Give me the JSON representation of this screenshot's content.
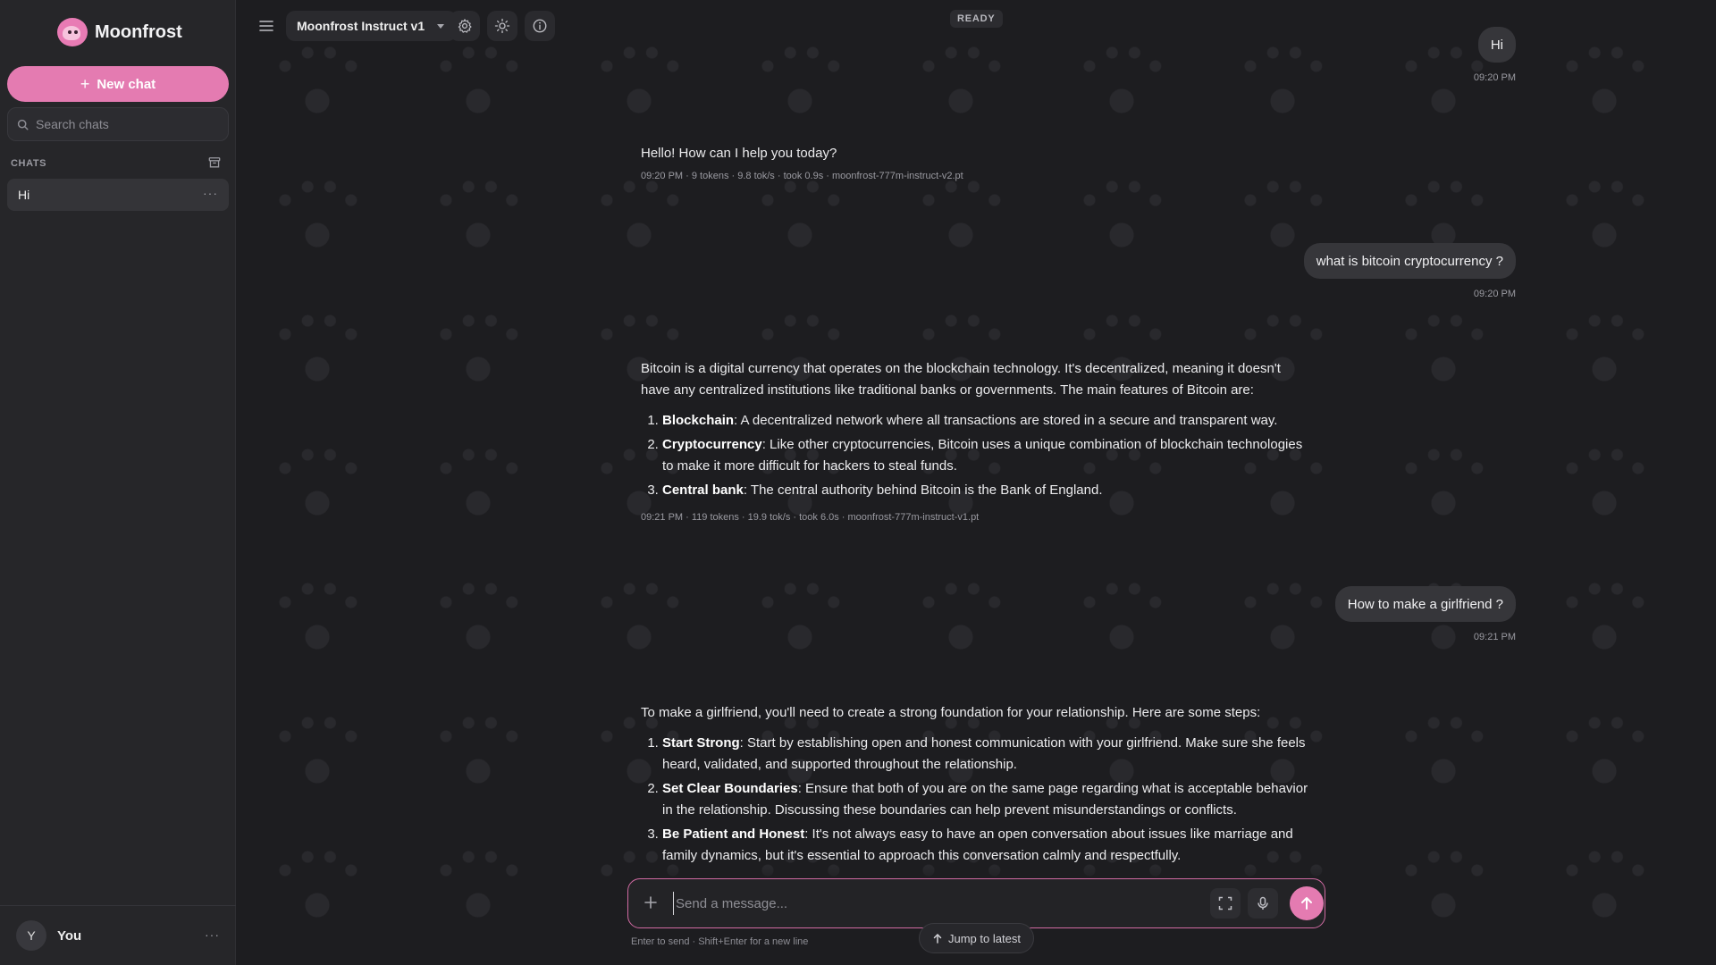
{
  "sidebar": {
    "brand": "Moonfrost",
    "new_chat": "New chat",
    "search_placeholder": "Search chats",
    "chats_label": "CHATS",
    "chats": [
      {
        "title": "Hi"
      }
    ],
    "user": {
      "initial": "Y",
      "name": "You"
    }
  },
  "topbar": {
    "model": "Moonfrost Instruct v1",
    "status": "READY"
  },
  "messages": {
    "m1": {
      "text": "Hi",
      "time": "09:20 PM"
    },
    "m2": {
      "text": "Hello! How can I help you today?",
      "meta": "09:20 PM · 9 tokens · 9.8 tok/s · took 0.9s · moonfrost-777m-instruct-v2.pt"
    },
    "m3": {
      "text": "what is bitcoin cryptocurrency ?",
      "time": "09:20 PM"
    },
    "m4": {
      "intro": "Bitcoin is a digital currency that operates on the blockchain technology. It's decentralized, meaning it doesn't have any centralized institutions like traditional banks or governments. The main features of Bitcoin are:",
      "items": [
        {
          "term": "Blockchain",
          "desc": ": A decentralized network where all transactions are stored in a secure and transparent way."
        },
        {
          "term": "Cryptocurrency",
          "desc": ": Like other cryptocurrencies, Bitcoin uses a unique combination of blockchain technologies to make it more difficult for hackers to steal funds."
        },
        {
          "term": "Central bank",
          "desc": ": The central authority behind Bitcoin is the Bank of England."
        }
      ],
      "meta": "09:21 PM · 119 tokens · 19.9 tok/s · took 6.0s · moonfrost-777m-instruct-v1.pt"
    },
    "m5": {
      "text": "How to make a girlfriend ?",
      "time": "09:21 PM"
    },
    "m6": {
      "intro": "To make a girlfriend, you'll need to create a strong foundation for your relationship. Here are some steps:",
      "items": [
        {
          "term": "Start Strong",
          "desc": ": Start by establishing open and honest communication with your girlfriend. Make sure she feels heard, validated, and supported throughout the relationship."
        },
        {
          "term": "Set Clear Boundaries",
          "desc": ": Ensure that both of you are on the same page regarding what is acceptable behavior in the relationship. Discussing these boundaries can help prevent misunderstandings or conflicts."
        },
        {
          "term": "Be Patient and Honest",
          "desc": ": It's not always easy to have an open conversation about issues like marriage and family dynamics, but it's essential to approach this conversation calmly and respectfully."
        }
      ]
    }
  },
  "composer": {
    "placeholder": "Send a message...",
    "hint": "Enter to send · Shift+Enter for a new line",
    "jump": "Jump to latest"
  },
  "colors": {
    "accent": "#e47bb1",
    "background": "#1d1d20",
    "sidebar": "#262629"
  }
}
